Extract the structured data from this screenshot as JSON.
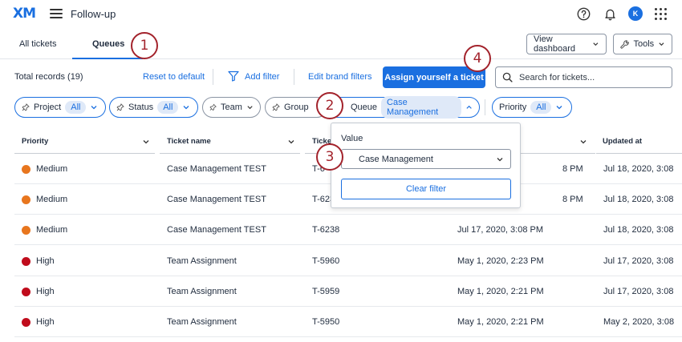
{
  "header": {
    "logo": "XM",
    "app_title": "Follow-up",
    "avatar_initial": "K"
  },
  "tabs": [
    {
      "label": "All tickets"
    },
    {
      "label": "Queues"
    }
  ],
  "top_buttons": {
    "view_dashboard": "View dashboard",
    "tools": "Tools"
  },
  "toolbar": {
    "total_records": "Total records (19)",
    "reset": "Reset to default",
    "add_filter": "Add filter",
    "edit_brand_filters": "Edit brand filters",
    "assign": "Assign yourself a ticket",
    "search_placeholder": "Search for tickets..."
  },
  "filters": {
    "project": {
      "label": "Project",
      "value": "All"
    },
    "status": {
      "label": "Status",
      "value": "All"
    },
    "team": {
      "label": "Team"
    },
    "group": {
      "label": "Group"
    },
    "queue": {
      "label": "Queue",
      "value": "Case Management"
    },
    "priority": {
      "label": "Priority",
      "value": "All"
    }
  },
  "popover": {
    "label": "Value",
    "selected": "Case Management",
    "clear": "Clear filter"
  },
  "table": {
    "columns": [
      "Priority",
      "Ticket name",
      "Ticket",
      "Updated at"
    ],
    "rows": [
      {
        "priority": "Medium",
        "color": "#e8761e",
        "name": "Case Management TEST",
        "ticket": "T-6",
        "created": "8 PM",
        "updated": "Jul 18, 2020, 3:08"
      },
      {
        "priority": "Medium",
        "color": "#e8761e",
        "name": "Case Management TEST",
        "ticket": "T-623",
        "created": "8 PM",
        "updated": "Jul 18, 2020, 3:08"
      },
      {
        "priority": "Medium",
        "color": "#e8761e",
        "name": "Case Management TEST",
        "ticket": "T-6238",
        "created": "Jul 17, 2020, 3:08 PM",
        "updated": "Jul 18, 2020, 3:08"
      },
      {
        "priority": "High",
        "color": "#c00c1c",
        "name": "Team Assignment",
        "ticket": "T-5960",
        "created": "May 1, 2020, 2:23 PM",
        "updated": "Jul 17, 2020, 3:08"
      },
      {
        "priority": "High",
        "color": "#c00c1c",
        "name": "Team Assignment",
        "ticket": "T-5959",
        "created": "May 1, 2020, 2:21 PM",
        "updated": "Jul 17, 2020, 3:08"
      },
      {
        "priority": "High",
        "color": "#c00c1c",
        "name": "Team Assignment",
        "ticket": "T-5950",
        "created": "May 1, 2020, 2:21 PM",
        "updated": "May 2, 2020, 3:08"
      }
    ]
  },
  "callouts": [
    "1",
    "2",
    "3",
    "4"
  ],
  "colors": {
    "accent": "#1a6fe0",
    "callout": "#a3232c",
    "medium": "#e8761e",
    "high": "#c00c1c"
  }
}
